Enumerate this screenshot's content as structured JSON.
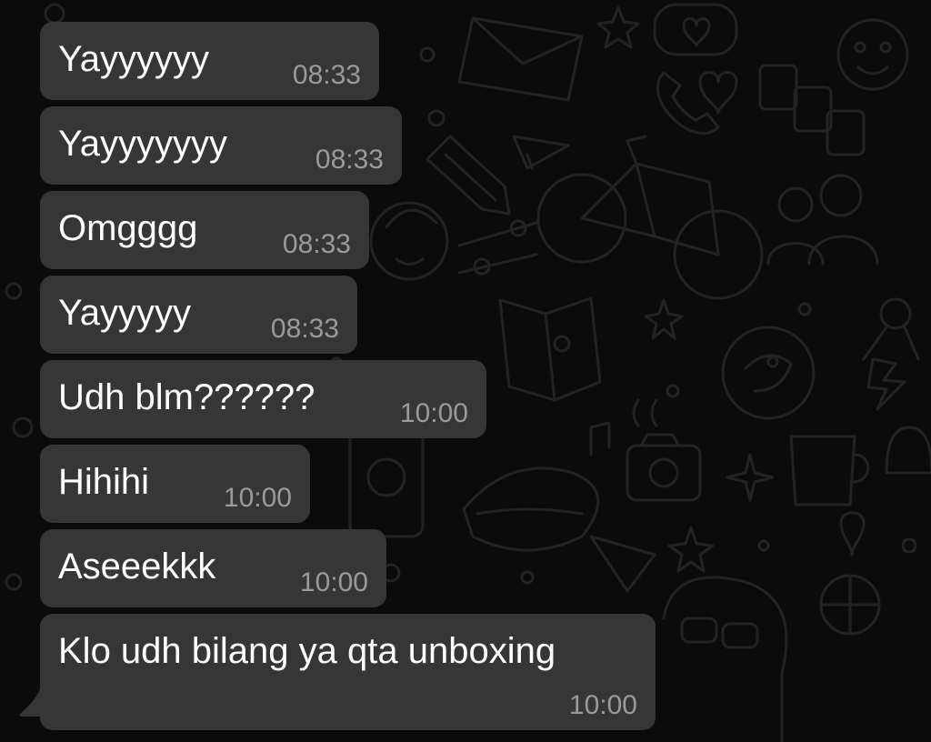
{
  "chat": {
    "wallpaper": {
      "pattern": "doodle-icons",
      "background_color": "#0b0b0b",
      "doodle_color": "#232323"
    },
    "bubble_color": "#363636",
    "text_color": "#ffffff",
    "time_color": "#9a9a9a",
    "messages": [
      {
        "text": "Yayyyyyy",
        "time": "08:33"
      },
      {
        "text": "Yayyyyyyy",
        "time": "08:33"
      },
      {
        "text": "Omgggg",
        "time": "08:33"
      },
      {
        "text": "Yayyyyy",
        "time": "08:33"
      },
      {
        "text": "Udh blm??????",
        "time": "10:00"
      },
      {
        "text": "Hihihi",
        "time": "10:00"
      },
      {
        "text": "Aseeekkk",
        "time": "10:00"
      },
      {
        "text": "Klo udh bilang ya qta unboxing",
        "time": "10:00"
      }
    ]
  }
}
